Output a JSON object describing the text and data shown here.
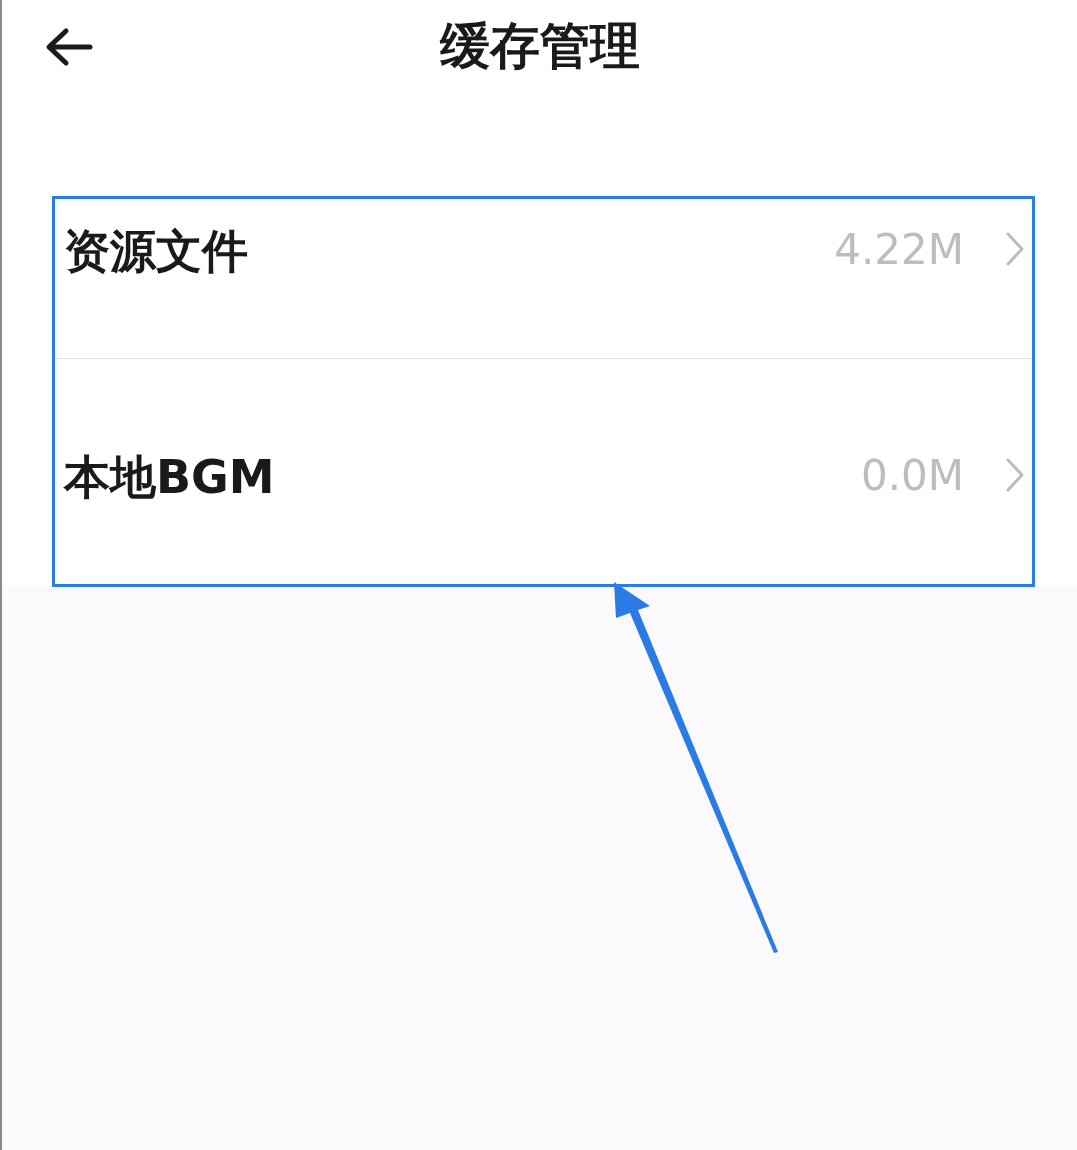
{
  "header": {
    "title": "缓存管理"
  },
  "items": [
    {
      "label": "资源文件",
      "value": "4.22M"
    },
    {
      "label": "本地BGM",
      "value": "0.0M"
    }
  ]
}
